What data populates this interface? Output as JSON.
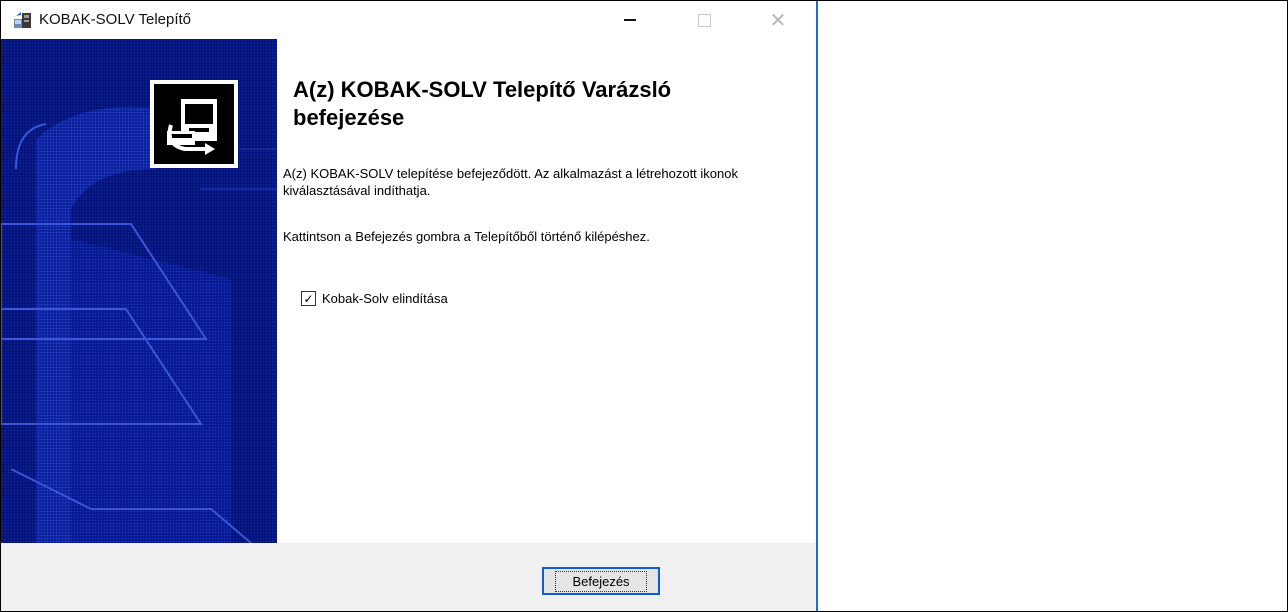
{
  "window": {
    "title": "KOBAK-SOLV Telepítő",
    "controls": {
      "minimize_icon": "minimize-icon",
      "maximize_icon": "maximize-icon",
      "close_icon": "close-icon"
    }
  },
  "content": {
    "heading": "A(z) KOBAK-SOLV Telepítő Varázsló befejezése",
    "paragraph1": "A(z) KOBAK-SOLV telepítése befejeződött. Az alkalmazást a létrehozott ikonok kiválasztásával indíthatja.",
    "paragraph2": "Kattintson a Befejezés gombra a Telepítőből történő kilépéshez.",
    "launch_checkbox": {
      "label": "Kobak-Solv elindítása",
      "checked": true,
      "check_glyph": "✓"
    }
  },
  "footer": {
    "finish_label": "Befejezés"
  },
  "colors": {
    "side_panel": "#000f6e",
    "window_border": "#1b6fd1",
    "focus_border": "#0e5bd8",
    "footer_bg": "#f0f0f0"
  }
}
